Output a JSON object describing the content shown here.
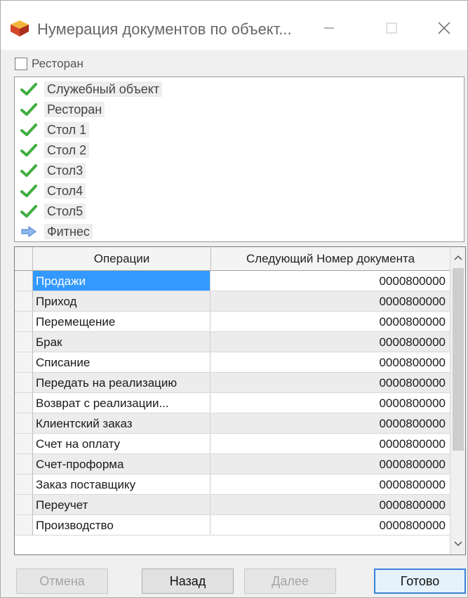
{
  "window": {
    "title": "Нумерация документов по объект...",
    "accent": "#3399ff"
  },
  "checkbox": {
    "label": "Ресторан",
    "checked": false
  },
  "objects": [
    {
      "label": "Служебный объект",
      "icon": "check-icon"
    },
    {
      "label": "Ресторан",
      "icon": "check-icon"
    },
    {
      "label": "Стол 1",
      "icon": "check-icon"
    },
    {
      "label": "Стол 2",
      "icon": "check-icon"
    },
    {
      "label": "Стол3",
      "icon": "check-icon"
    },
    {
      "label": "Стол4",
      "icon": "check-icon"
    },
    {
      "label": "Стол5",
      "icon": "check-icon"
    },
    {
      "label": "Фитнес",
      "icon": "arrow-right-icon"
    }
  ],
  "grid": {
    "headers": [
      "Операции",
      "Следующий Номер документа"
    ],
    "rows": [
      {
        "op": "Продажи",
        "num": "0000800000"
      },
      {
        "op": "Приход",
        "num": "0000800000"
      },
      {
        "op": "Перемещение",
        "num": "0000800000"
      },
      {
        "op": "Брак",
        "num": "0000800000"
      },
      {
        "op": "Списание",
        "num": "0000800000"
      },
      {
        "op": "Передать на реализацию",
        "num": "0000800000"
      },
      {
        "op": "Возврат с реализации...",
        "num": "0000800000"
      },
      {
        "op": "Клиентский заказ",
        "num": "0000800000"
      },
      {
        "op": "Счет на оплату",
        "num": "0000800000"
      },
      {
        "op": "Счет-проформа",
        "num": "0000800000"
      },
      {
        "op": "Заказ поставщику",
        "num": "0000800000"
      },
      {
        "op": "Переучет",
        "num": "0000800000"
      },
      {
        "op": "Производство",
        "num": "0000800000"
      }
    ]
  },
  "buttons": {
    "cancel": "Отмена",
    "back": "Назад",
    "next": "Далее",
    "done": "Готово"
  }
}
